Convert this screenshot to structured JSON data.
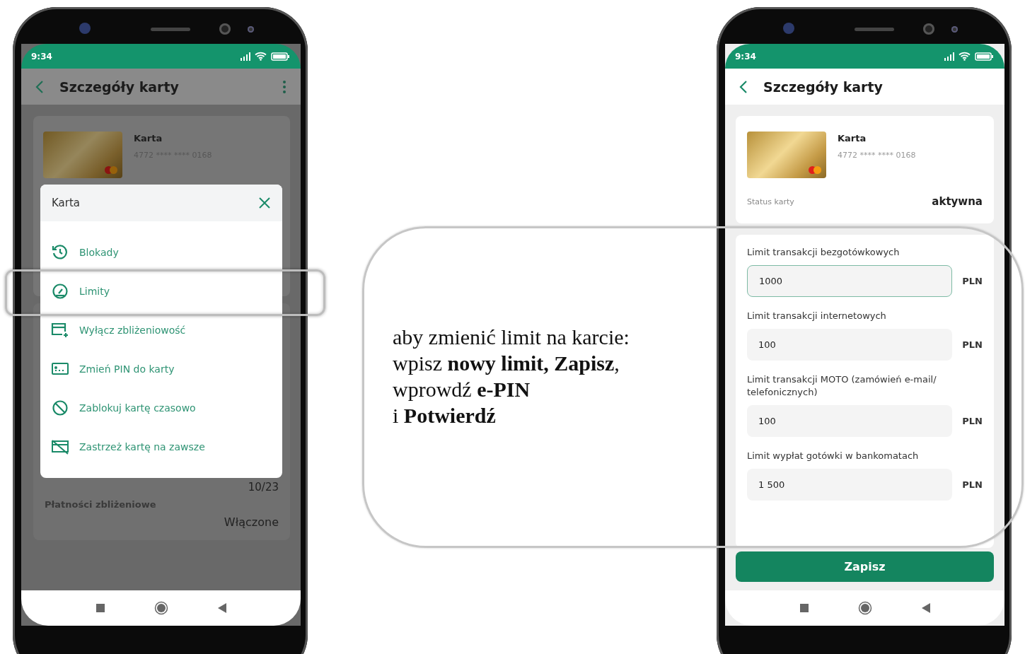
{
  "left_phone": {
    "status_bar": {
      "time": "9:34"
    },
    "header": {
      "title": "Szczegóły karty"
    },
    "card": {
      "name": "Karta",
      "number": "4772 **** **** 0168"
    },
    "background_card": {
      "expiry": "10/23",
      "contactless_label": "Płatności zbliżeniowe",
      "contactless_value": "Włączone"
    },
    "sheet": {
      "title": "Karta",
      "items": [
        {
          "label": "Blokady",
          "kind": "history",
          "selected": false,
          "highlighted": false
        },
        {
          "label": "Limity",
          "kind": "gauge",
          "selected": false,
          "highlighted": true
        },
        {
          "label": "Wyłącz zbliżeniowość",
          "kind": "addcard",
          "selected": false,
          "highlighted": false
        },
        {
          "label": "Zmień PIN do karty",
          "kind": "pin",
          "selected": false,
          "highlighted": false
        },
        {
          "label": "Zablokuj kartę czasowo",
          "kind": "block",
          "selected": false,
          "highlighted": false
        },
        {
          "label": "Zastrzeż kartę na zawsze",
          "kind": "cardoff",
          "selected": false,
          "highlighted": false
        }
      ]
    }
  },
  "callout": {
    "lines": [
      "aby zmienić limit na karcie:",
      "wpisz **nowy limit, Zapisz**,",
      "wprowdź **e-PIN**",
      "i **Potwierdź**"
    ]
  },
  "right_phone": {
    "status_bar": {
      "time": "9:34"
    },
    "header": {
      "title": "Szczegóły karty"
    },
    "card": {
      "name": "Karta",
      "number": "4772 **** **** 0168",
      "status_label": "Status karty",
      "status_value": "aktywna"
    },
    "limits": [
      {
        "label": "Limit transakcji bezgotówkowych",
        "value": "1000",
        "currency": "PLN",
        "focused": true
      },
      {
        "label": "Limit transakcji internetowych",
        "value": "100",
        "currency": "PLN",
        "focused": false
      },
      {
        "label": "Limit transakcji MOTO (zamówień e-mail/ telefonicznych)",
        "value": "100",
        "currency": "PLN",
        "focused": false
      },
      {
        "label": "Limit wypłat gotówki w bankomatach",
        "value": "1 500",
        "currency": "PLN",
        "focused": false
      }
    ],
    "save_button": "Zapisz"
  }
}
